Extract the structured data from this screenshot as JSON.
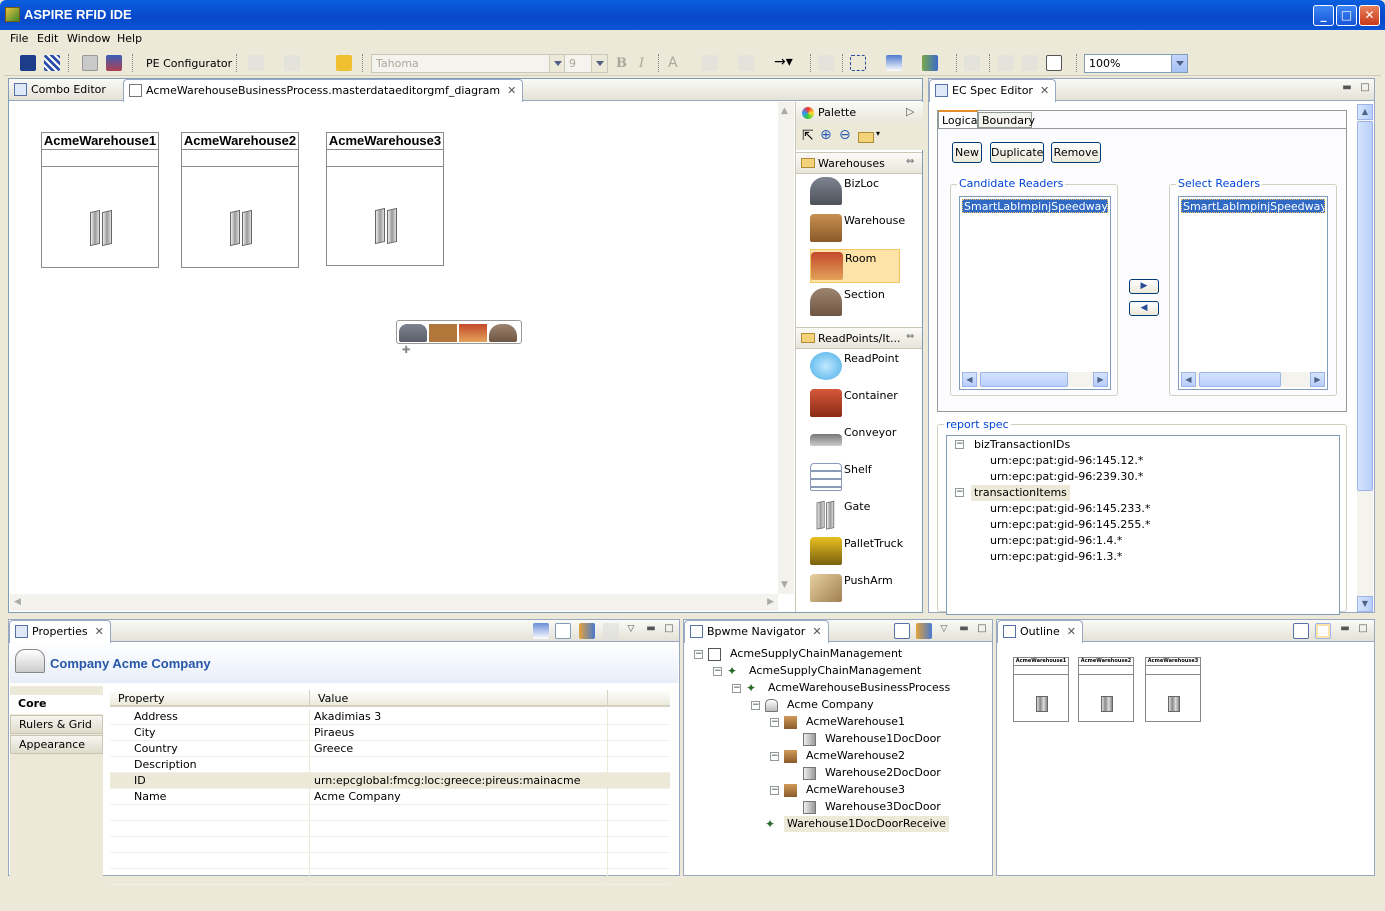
{
  "window": {
    "title": "ASPIRE RFID IDE"
  },
  "menu": [
    "File",
    "Edit",
    "Window",
    "Help"
  ],
  "toolbar": {
    "pe_configurator": "PE Configurator",
    "font": "Tahoma",
    "font_size": "9",
    "bold": "B",
    "italic": "I",
    "font_color": "A",
    "zoom": "100%"
  },
  "editor": {
    "tabs": [
      {
        "label": "Combo Editor"
      },
      {
        "label": "AcmeWarehouseBusinessProcess.masterdataeditorgmf_diagram"
      }
    ],
    "warehouses": [
      "AcmeWarehouse1",
      "AcmeWarehouse2",
      "AcmeWarehouse3"
    ]
  },
  "palette": {
    "title": "Palette",
    "drawers": [
      {
        "label": "Warehouses",
        "items": [
          "BizLoc",
          "Warehouse",
          "Room",
          "Section"
        ]
      },
      {
        "label": "ReadPoints/It...",
        "items": [
          "ReadPoint",
          "Container",
          "Conveyor",
          "Shelf",
          "Gate",
          "PalletTruck",
          "PushArm"
        ]
      }
    ]
  },
  "ecspec": {
    "tab": "EC Spec Editor",
    "subtabs": [
      "Logical",
      "Boundary"
    ],
    "buttons": [
      "New",
      "Duplicate",
      "Remove"
    ],
    "candidate_label": "Candidate Readers",
    "select_label": "Select Readers",
    "candidate_items": [
      "SmartLabImpinjSpeedwayLogic"
    ],
    "select_items": [
      "SmartLabImpinjSpeedwayLogi"
    ],
    "report_label": "report spec",
    "tree": [
      {
        "label": "bizTransactionIDs",
        "children": [
          "urn:epc:pat:gid-96:145.12.*",
          "urn:epc:pat:gid-96:239.30.*"
        ]
      },
      {
        "label": "transactionItems",
        "children": [
          "urn:epc:pat:gid-96:145.233.*",
          "urn:epc:pat:gid-96:145.255.*",
          "urn:epc:pat:gid-96:1.4.*",
          "urn:epc:pat:gid-96:1.3.*"
        ]
      }
    ]
  },
  "properties": {
    "tab": "Properties",
    "header": "Company Acme Company",
    "side_tabs": [
      "Core",
      "Rulers & Grid",
      "Appearance"
    ],
    "columns": [
      "Property",
      "Value"
    ],
    "rows": [
      {
        "p": "Address",
        "v": "Akadimias 3"
      },
      {
        "p": "City",
        "v": "Piraeus"
      },
      {
        "p": "Country",
        "v": "Greece"
      },
      {
        "p": "Description",
        "v": ""
      },
      {
        "p": "ID",
        "v": "urn:epcglobal:fmcg:loc:greece:pireus:mainacme"
      },
      {
        "p": "Name",
        "v": "Acme Company"
      }
    ]
  },
  "navigator": {
    "tab": "Bpwme Navigator",
    "items": [
      "AcmeSupplyChainManagement",
      "AcmeSupplyChainManagement",
      "AcmeWarehouseBusinessProcess",
      "Acme Company",
      "AcmeWarehouse1",
      "Warehouse1DocDoor",
      "AcmeWarehouse2",
      "Warehouse2DocDoor",
      "AcmeWarehouse3",
      "Warehouse3DocDoor",
      "Warehouse1DocDoorReceive"
    ]
  },
  "outline": {
    "tab": "Outline",
    "thumbs": [
      "AcmeWarehouse1",
      "AcmeWarehouse2",
      "AcmeWarehouse3"
    ]
  }
}
